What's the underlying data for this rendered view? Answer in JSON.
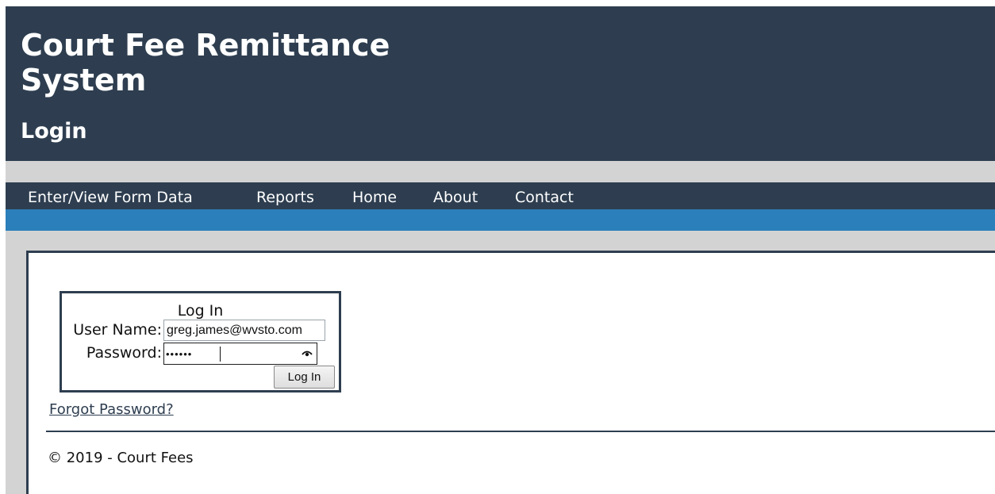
{
  "header": {
    "site_title": "Court Fee Remittance System",
    "page_heading": "Login"
  },
  "nav": {
    "items": [
      {
        "label": "Enter/View Form Data"
      },
      {
        "label": "Reports"
      },
      {
        "label": "Home"
      },
      {
        "label": "About"
      },
      {
        "label": "Contact"
      }
    ]
  },
  "login": {
    "title": "Log In",
    "username_label": "User Name:",
    "username_value": "greg.james@wvsto.com",
    "password_label": "Password:",
    "password_masked": "••••••",
    "password_reveal_icon": "eye-icon",
    "submit_label": "Log In"
  },
  "forgot_password": "Forgot Password?",
  "footer": {
    "copyright": "© 2019 - Court Fees"
  },
  "colors": {
    "header_bg": "#2e3e50",
    "accent": "#2b7fba",
    "page_bg": "#d3d3d3"
  }
}
